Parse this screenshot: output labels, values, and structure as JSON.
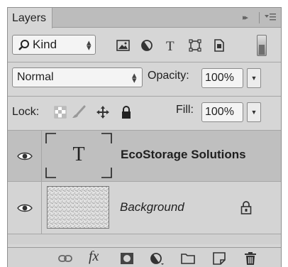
{
  "panel": {
    "tab_label": "Layers",
    "collapse_glyph": "▸▸",
    "menu_icon": "panel-menu-icon"
  },
  "filter": {
    "kind_label": "Kind",
    "search_icon": "search-icon",
    "filter_icons": [
      "pixel-filter-icon",
      "adjustment-filter-icon",
      "type-filter-icon",
      "shape-filter-icon",
      "smart-object-filter-icon"
    ]
  },
  "blend": {
    "mode": "Normal",
    "opacity_label": "Opacity:",
    "opacity_value": "100%"
  },
  "lock": {
    "label": "Lock:",
    "icons": [
      "lock-transparent-icon",
      "lock-image-icon",
      "lock-position-icon",
      "lock-all-icon"
    ],
    "fill_label": "Fill:",
    "fill_value": "100%"
  },
  "layers": [
    {
      "name": "EcoStorage Solutions",
      "type": "text",
      "thumb_glyph": "T",
      "visible": true,
      "selected": true
    },
    {
      "name": "Background",
      "type": "background",
      "visible": true,
      "locked": true
    }
  ],
  "footer": {
    "icons": [
      "link-layers-icon",
      "fx-icon",
      "add-mask-icon",
      "adjustment-layer-icon",
      "new-group-icon",
      "new-layer-icon",
      "trash-icon"
    ],
    "fx_label": "fx"
  }
}
